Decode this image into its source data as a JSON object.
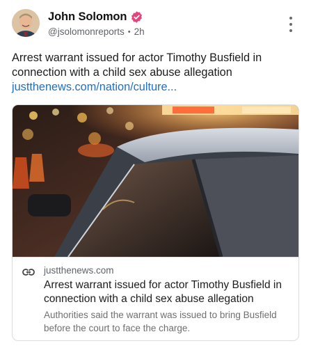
{
  "post": {
    "author_name": "John Solomon",
    "handle": "@jsolomonreports",
    "separator": "•",
    "time": "2h",
    "text": "Arrest warrant issued for actor Timothy Busfield in connection with a child sex abuse allegation",
    "link_text": "justthenews.com/nation/culture..."
  },
  "card": {
    "domain": "justthenews.com",
    "title": "Arrest warrant issued for actor Timothy Busfield in connection with a child sex abuse allegation",
    "description": "Authorities said the warrant was issued to bring Busfield before the court to face the charge."
  },
  "icons": {
    "verified": "verified-badge-icon",
    "more": "more-vertical-icon",
    "link": "link-icon"
  },
  "colors": {
    "verified_badge": "#e0457b",
    "link": "#1f6fc5"
  }
}
